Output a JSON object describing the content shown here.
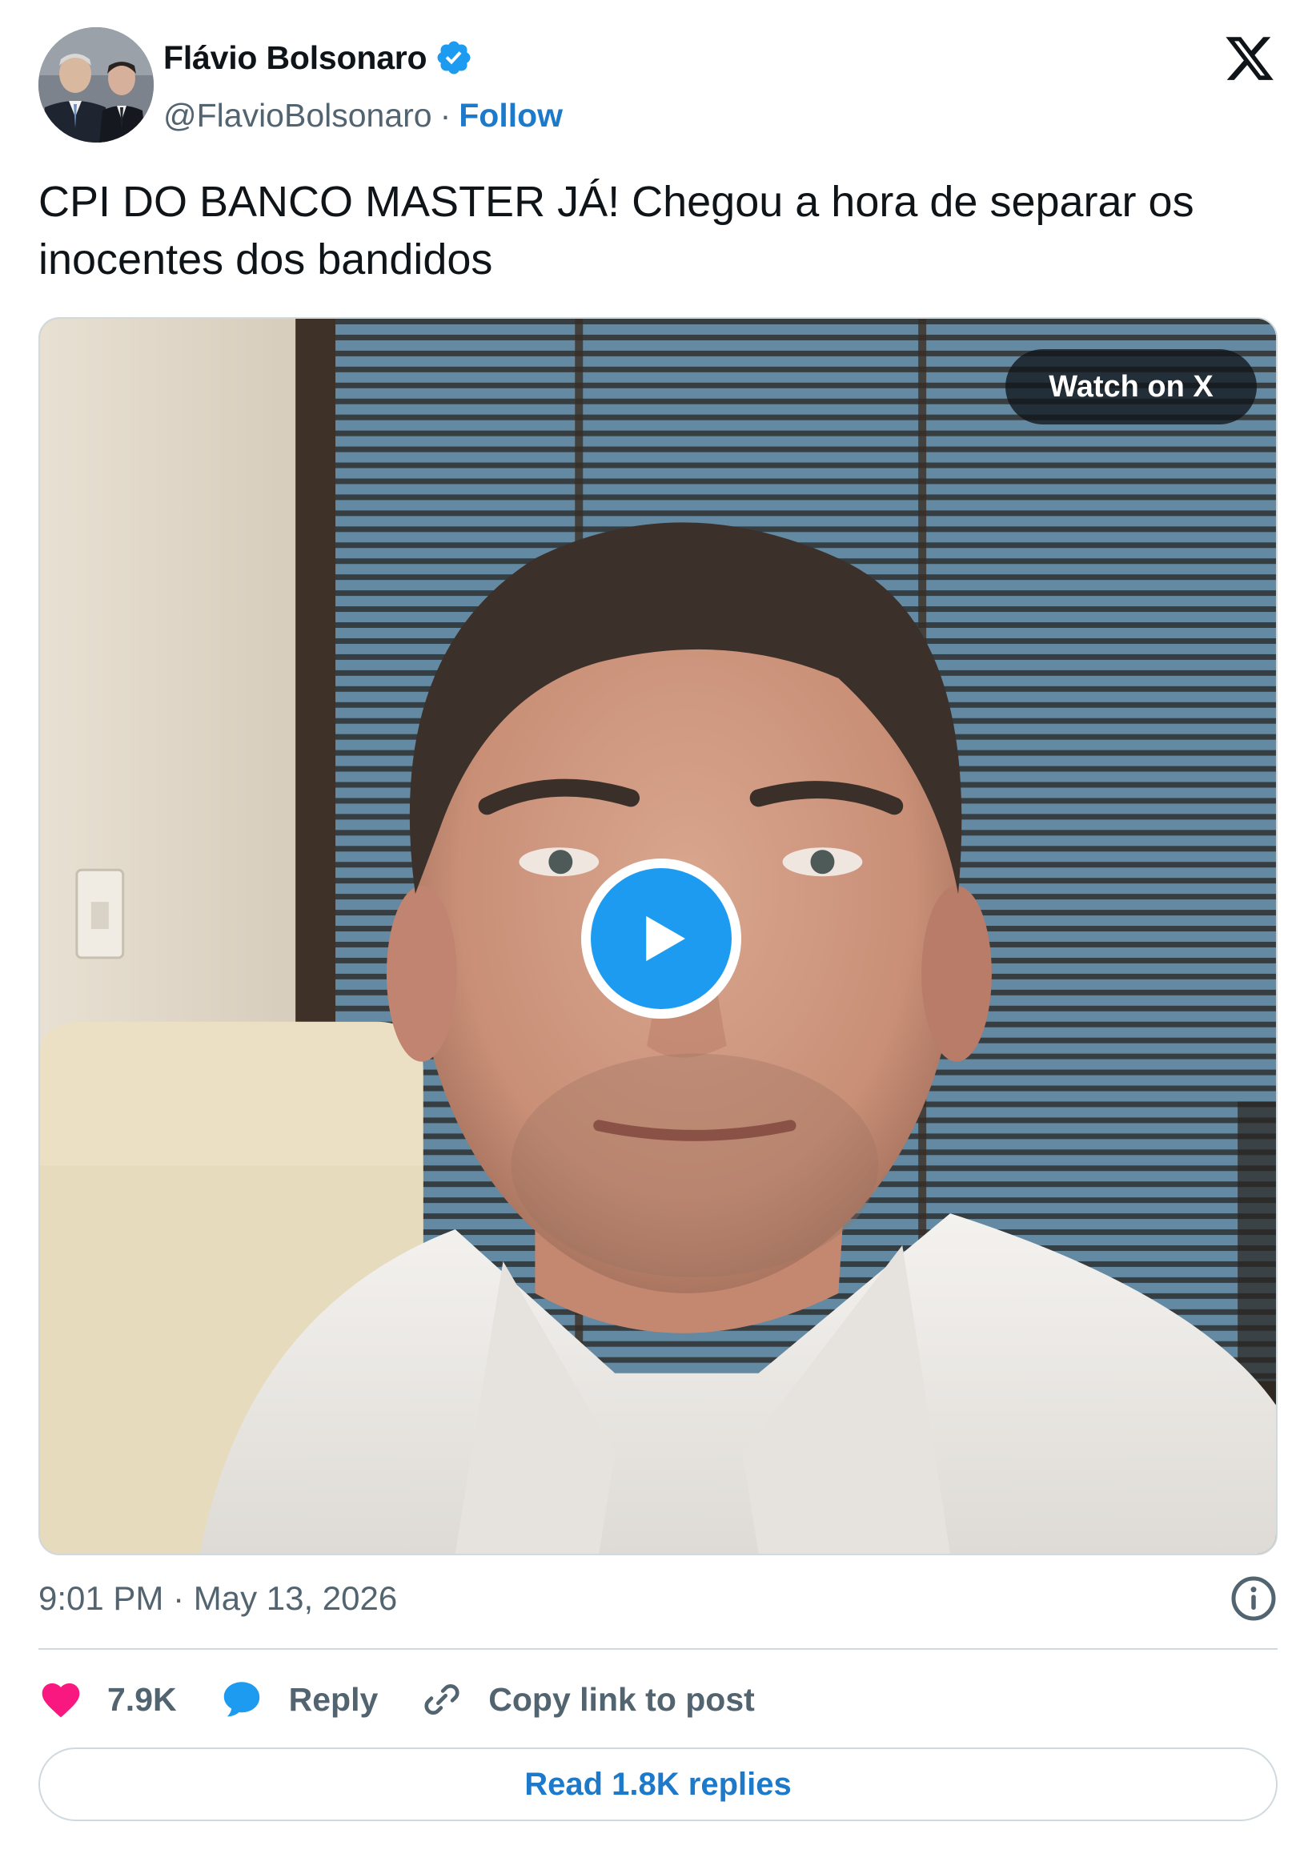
{
  "author": {
    "display_name": "Flávio Bolsonaro",
    "handle": "@FlavioBolsonaro",
    "separator": "·",
    "follow_label": "Follow",
    "verified_color": "#1d9bf0"
  },
  "tweet": {
    "text": "CPI DO BANCO MASTER JÁ! Chegou a hora de separar os inocentes dos bandidos"
  },
  "media": {
    "watch_label": "Watch on X",
    "play_icon": "play-icon"
  },
  "meta": {
    "timestamp": "9:01 PM · May 13, 2026"
  },
  "actions": {
    "like_count": "7.9K",
    "reply_label": "Reply",
    "copy_label": "Copy link to post"
  },
  "footer": {
    "read_replies_label": "Read 1.8K replies"
  },
  "colors": {
    "accent": "#1d79c9",
    "like": "#f91880",
    "muted": "#536471",
    "border": "#cfd9de"
  }
}
